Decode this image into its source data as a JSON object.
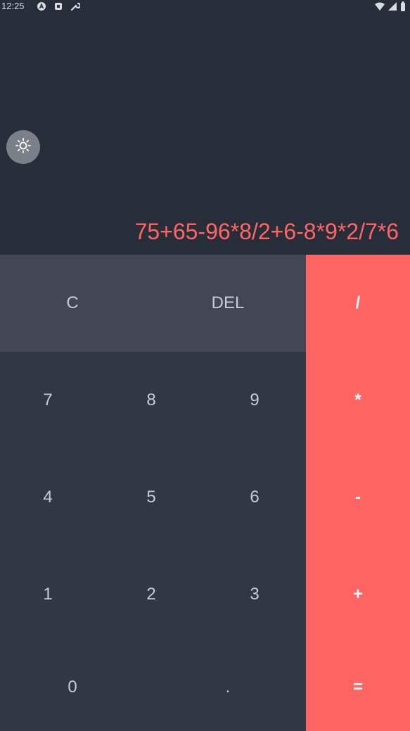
{
  "status_bar": {
    "time": "12:25",
    "left_icons": [
      "app-a-icon",
      "debug-icon",
      "wrench-icon"
    ],
    "right_icons": [
      "wifi-icon",
      "signal-icon",
      "battery-icon"
    ]
  },
  "theme_toggle": {
    "icon": "sun-icon"
  },
  "display": {
    "expression": "75+65-96*8/2+6-8*9*2/7*6"
  },
  "keypad": {
    "clear": "C",
    "delete": "DEL",
    "divide": "/",
    "multiply": "*",
    "subtract": "-",
    "add": "+",
    "equals": "=",
    "digits": {
      "d7": "7",
      "d8": "8",
      "d9": "9",
      "d4": "4",
      "d5": "5",
      "d6": "6",
      "d1": "1",
      "d2": "2",
      "d3": "3",
      "d0": "0"
    },
    "decimal": "."
  },
  "colors": {
    "background": "#282d3a",
    "accent": "#ff6563",
    "top_row": "#424753",
    "num_area": "#313845",
    "toggle": "#7b7f88"
  }
}
